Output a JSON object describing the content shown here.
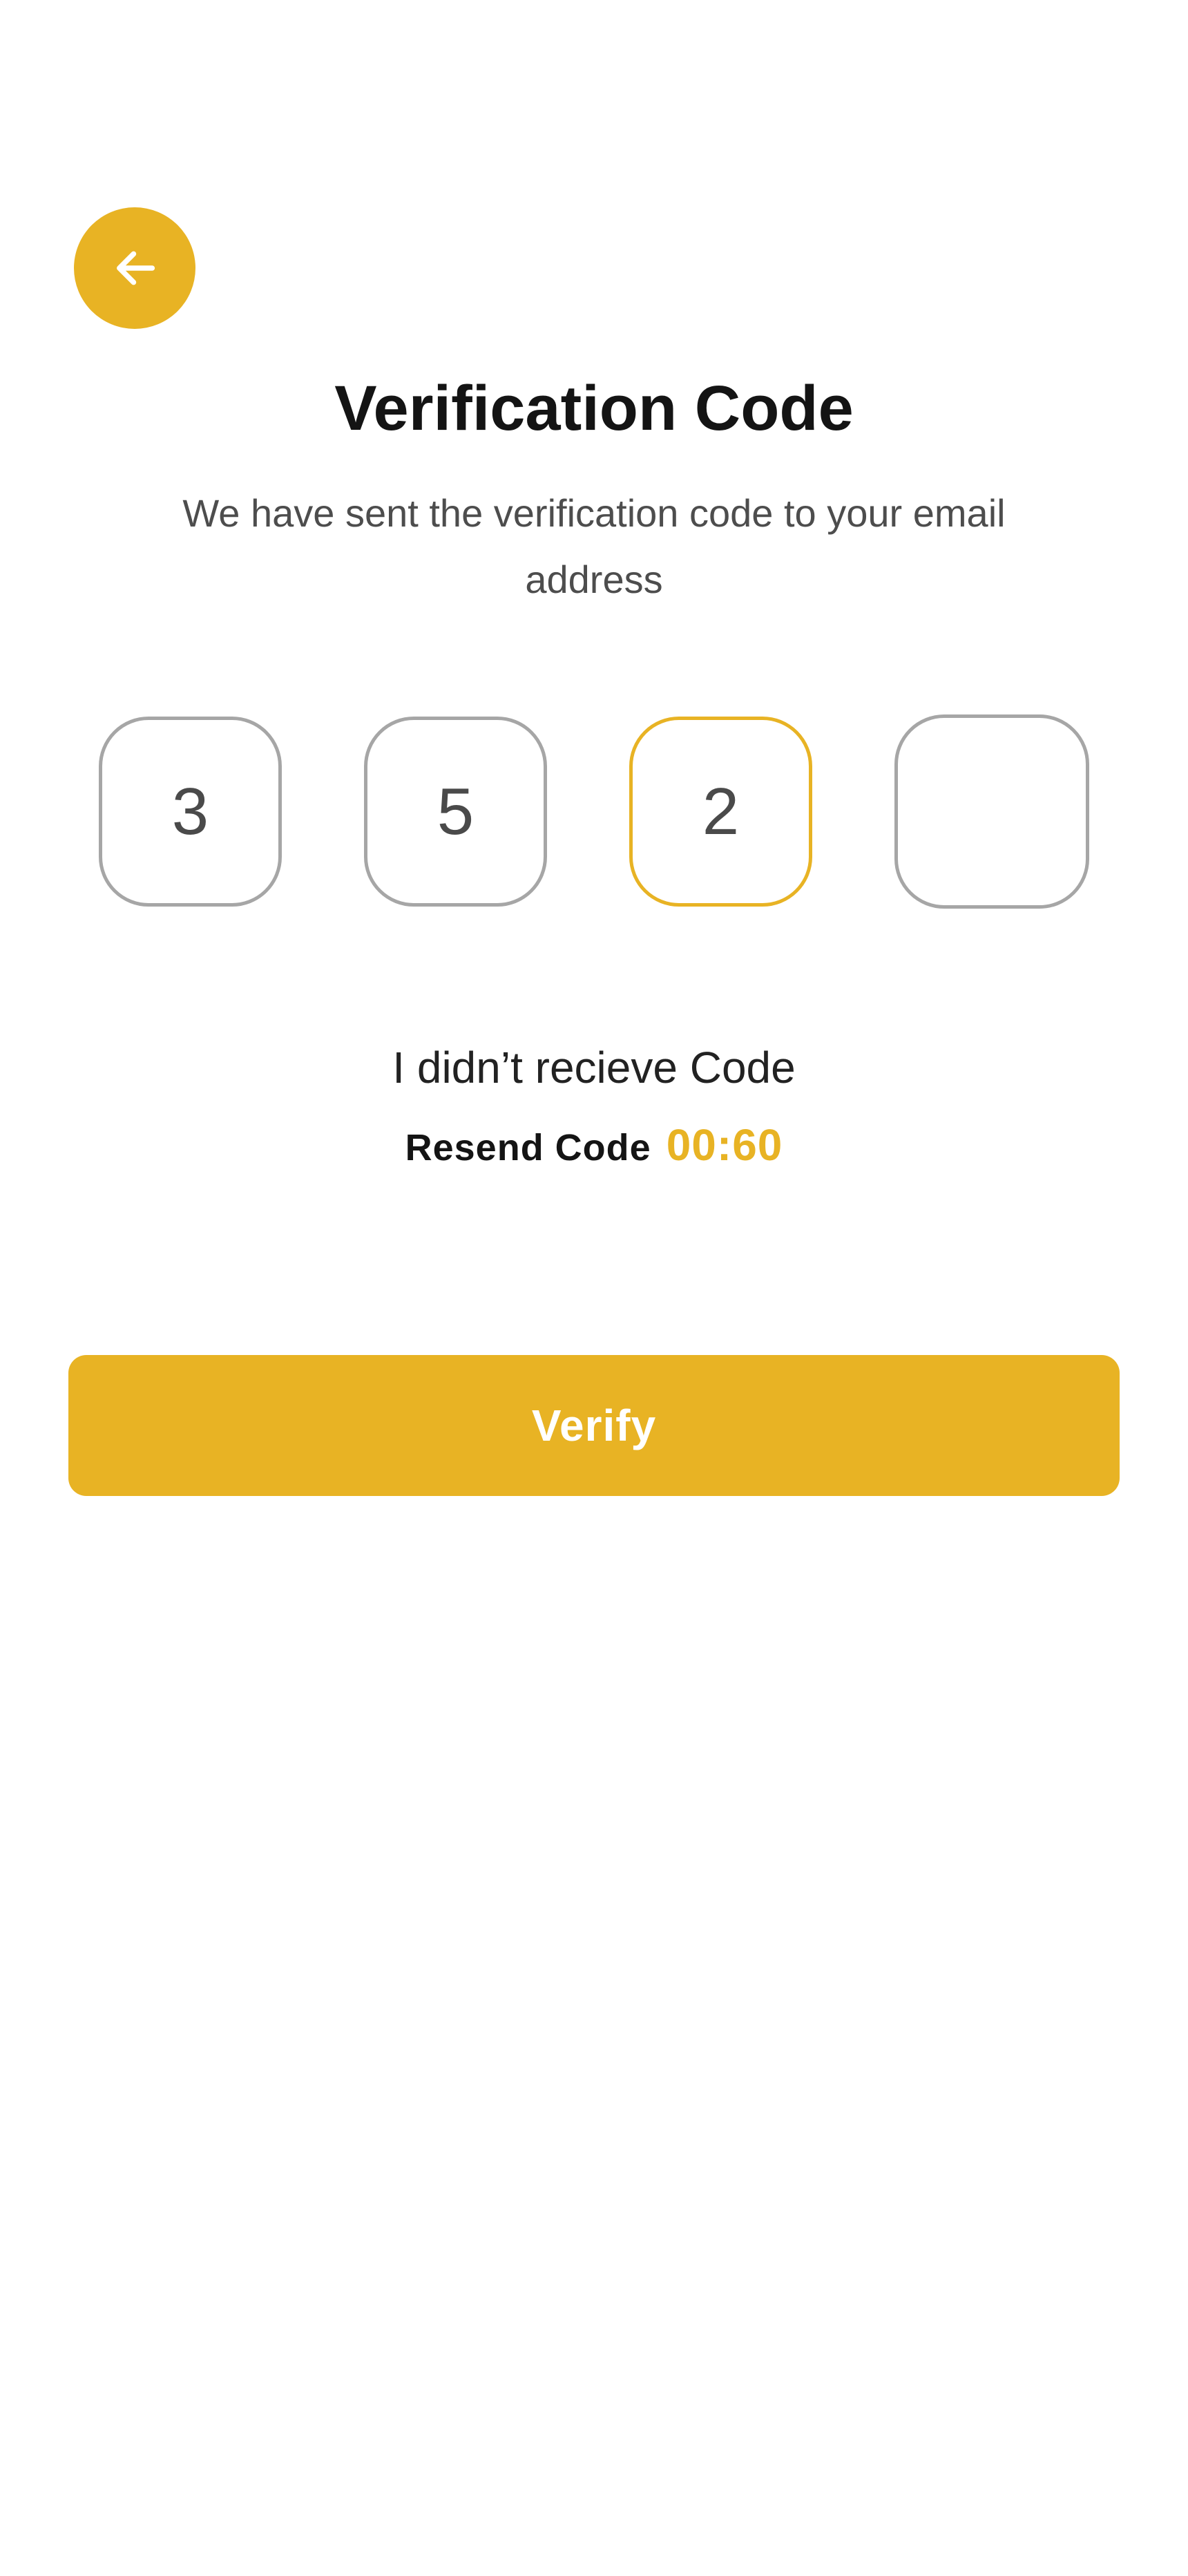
{
  "header": {
    "back_icon": "arrow-left-icon",
    "title": "Verification Code",
    "subtitle": "We have sent the verification code to your email address"
  },
  "otp": {
    "digits": [
      "3",
      "5",
      "2",
      ""
    ],
    "active_index": 2
  },
  "resend": {
    "prompt": "I didn’t recieve Code",
    "label": "Resend Code",
    "timer": "00:60"
  },
  "actions": {
    "verify_label": "Verify"
  },
  "colors": {
    "accent": "#E8B324",
    "box_border": "#A6A6A6",
    "title": "#141414",
    "subtitle": "#4D4D4D"
  }
}
